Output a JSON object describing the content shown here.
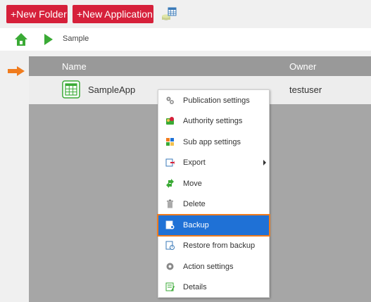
{
  "toolbar": {
    "new_folder_label": "+New Folder",
    "new_application_label": "+New Application",
    "accent": "#d6203a"
  },
  "breadcrumb": {
    "current": "Sample"
  },
  "table": {
    "columns": [
      "Name",
      "Owner"
    ],
    "rows": [
      {
        "name": "SampleApp",
        "owner": "testuser"
      }
    ]
  },
  "context_menu": {
    "items": [
      {
        "label": "Publication settings",
        "icon": "gears-icon"
      },
      {
        "label": "Authority settings",
        "icon": "authority-icon"
      },
      {
        "label": "Sub app settings",
        "icon": "sub-app-icon"
      },
      {
        "label": "Export",
        "icon": "export-icon",
        "submenu": true
      },
      {
        "label": "Move",
        "icon": "move-icon"
      },
      {
        "label": "Delete",
        "icon": "trash-icon"
      },
      {
        "label": "Backup",
        "icon": "backup-icon",
        "active": true
      },
      {
        "label": "Restore from backup",
        "icon": "restore-icon"
      },
      {
        "label": "Action settings",
        "icon": "gear-icon"
      },
      {
        "label": "Details",
        "icon": "details-icon"
      }
    ],
    "highlight_color": "#1f71d6",
    "highlight_outline": "#f07c1e"
  }
}
